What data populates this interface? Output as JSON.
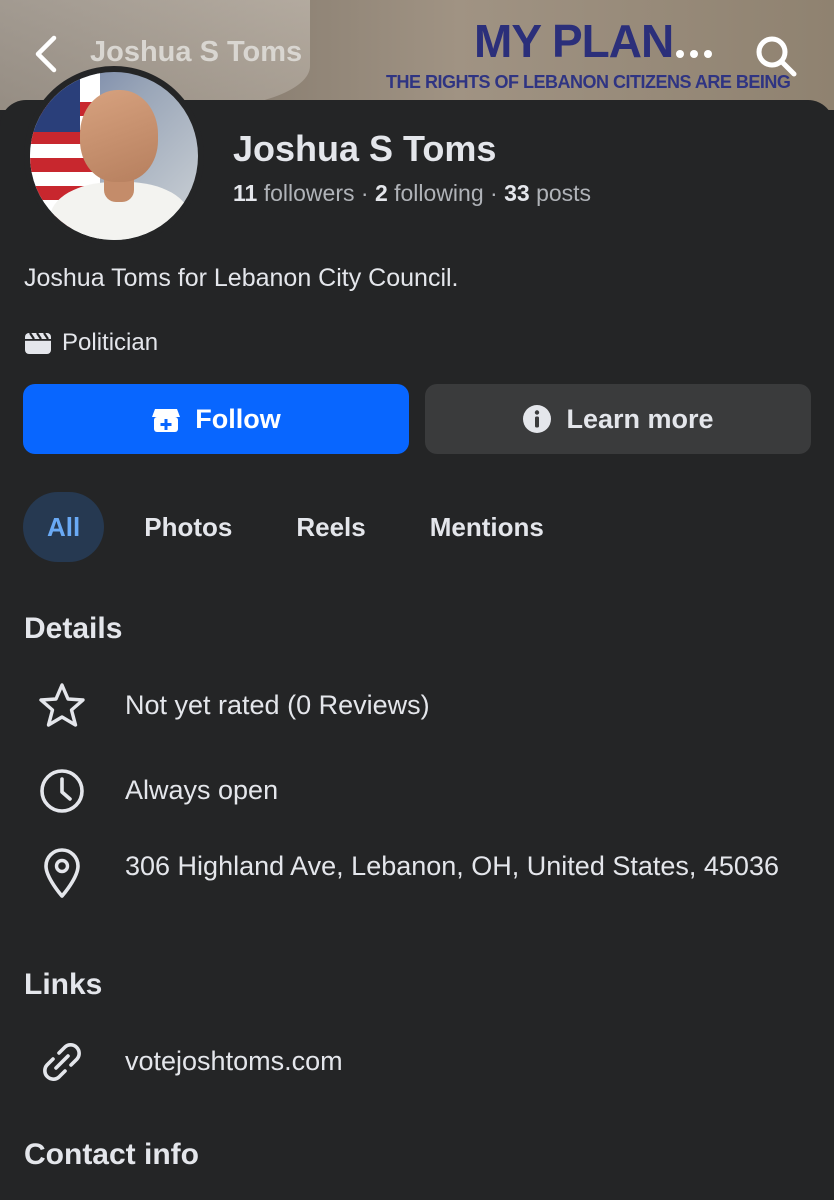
{
  "cover": {
    "headline": "MY PLAN",
    "subhead": "THE RIGHTS OF LEBANON CITIZENS ARE BEING"
  },
  "topbar": {
    "title": "Joshua S Toms",
    "back_icon": "chevron-left-icon",
    "more_icon": "more-horizontal-icon",
    "search_icon": "search-icon"
  },
  "profile": {
    "name": "Joshua S Toms",
    "followers_count": "11",
    "followers_label": "followers",
    "following_count": "2",
    "following_label": "following",
    "posts_count": "33",
    "posts_label": "posts",
    "separator": "·",
    "bio": "Joshua Toms for Lebanon City Council.",
    "category": "Politician"
  },
  "actions": {
    "follow_label": "Follow",
    "learn_more_label": "Learn more"
  },
  "tabs": [
    {
      "label": "All",
      "active": true
    },
    {
      "label": "Photos",
      "active": false
    },
    {
      "label": "Reels",
      "active": false
    },
    {
      "label": "Mentions",
      "active": false
    }
  ],
  "details": {
    "title": "Details",
    "rating": "Not yet rated (0 Reviews)",
    "hours": "Always open",
    "address": "306 Highland Ave, Lebanon, OH, United States, 45036"
  },
  "links": {
    "title": "Links",
    "website": "votejoshtoms.com"
  },
  "contact": {
    "title": "Contact info"
  },
  "colors": {
    "background": "#242526",
    "primary_button": "#0866ff",
    "secondary_button": "#3a3b3c",
    "active_tab_bg": "#263951",
    "active_tab_text": "#6aaaf5"
  }
}
